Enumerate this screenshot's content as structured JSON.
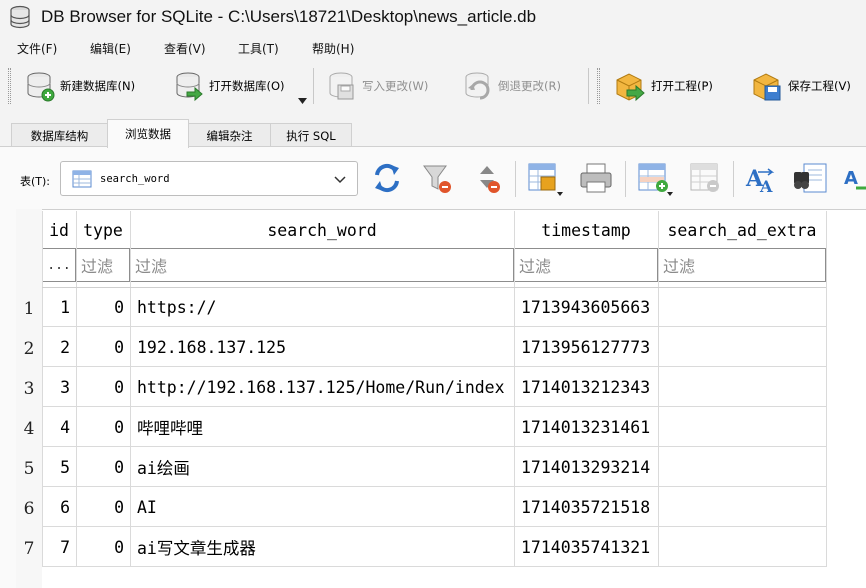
{
  "window": {
    "title": "DB Browser for SQLite - C:\\Users\\18721\\Desktop\\news_article.db"
  },
  "menu": [
    "文件(F)",
    "编辑(E)",
    "查看(V)",
    "工具(T)",
    "帮助(H)"
  ],
  "toolbar": {
    "new_db": "新建数据库(N)",
    "open_db": "打开数据库(O)",
    "write_changes": "写入更改(W)",
    "revert_changes": "倒退更改(R)",
    "open_project": "打开工程(P)",
    "save_project": "保存工程(V)"
  },
  "tabs": [
    "数据库结构",
    "浏览数据",
    "编辑杂注",
    "执行 SQL"
  ],
  "browse": {
    "table_label": "表(T):",
    "table_name": "search_word"
  },
  "grid": {
    "columns": [
      "id",
      "type",
      "search_word",
      "timestamp",
      "search_ad_extra"
    ],
    "filter_placeholder": "过滤",
    "row_header_filter": "...",
    "row_numbers": [
      "1",
      "2",
      "3",
      "4",
      "5",
      "6",
      "7"
    ],
    "rows": [
      [
        "1",
        "0",
        "https://",
        "1713943605663",
        ""
      ],
      [
        "2",
        "0",
        "192.168.137.125",
        "1713956127773",
        ""
      ],
      [
        "3",
        "0",
        "http://192.168.137.125/Home/Run/index",
        "1714013212343",
        ""
      ],
      [
        "4",
        "0",
        "哔哩哔哩",
        "1714013231461",
        ""
      ],
      [
        "5",
        "0",
        "ai绘画",
        "1714013293214",
        ""
      ],
      [
        "6",
        "0",
        "AI",
        "1714035721518",
        ""
      ],
      [
        "7",
        "0",
        "ai写文章生成器",
        "1714035741321",
        ""
      ]
    ]
  },
  "icons": [
    "db-app-icon",
    "new-database-icon",
    "open-database-icon",
    "write-changes-icon",
    "revert-changes-icon",
    "open-project-icon",
    "save-project-icon",
    "table-icon",
    "refresh-icon",
    "clear-filter-icon",
    "clear-sort-icon",
    "save-results-icon",
    "print-icon",
    "insert-record-icon",
    "delete-record-icon",
    "find-replace-icon",
    "find-icon",
    "edit-cell-icon",
    "chevron-down-icon"
  ]
}
